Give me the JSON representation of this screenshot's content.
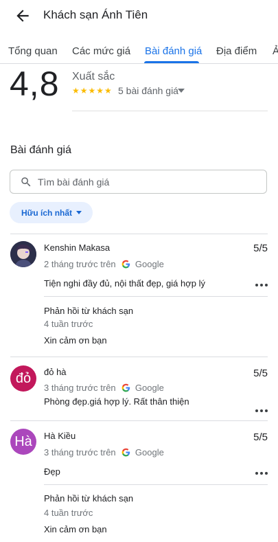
{
  "header": {
    "title": "Khách sạn Ánh Tiên"
  },
  "tabs": [
    {
      "label": "Tổng quan"
    },
    {
      "label": "Các mức giá"
    },
    {
      "label": "Bài đánh giá"
    },
    {
      "label": "Địa điểm"
    },
    {
      "label": "Ả"
    }
  ],
  "summary": {
    "score": "4,8",
    "label": "Xuất sắc",
    "stars": "★★★★★",
    "count": "5 bài đánh giá"
  },
  "reviews_section": {
    "title": "Bài đánh giá",
    "search_placeholder": "Tìm bài đánh giá",
    "sort_label": "Hữu ích nhất"
  },
  "reviews": [
    {
      "name": "Kenshin Makasa",
      "time": "2 tháng trước trên",
      "source": "Google",
      "rating": "5/5",
      "text": "Tiện nghi đầy đủ, nội thất đẹp, giá hợp lý",
      "reply": {
        "title": "Phản hồi từ khách sạn",
        "date": "4 tuần trước",
        "text": "Xin cảm ơn bạn"
      }
    },
    {
      "name": "đỏ hà",
      "initial": "đỏ",
      "avatar_color": "#c2185b",
      "time": "3 tháng trước trên",
      "source": "Google",
      "rating": "5/5",
      "text": "Phòng đẹp.giá hợp lý. Rất thân thiện"
    },
    {
      "name": "Hà Kiều",
      "initial": "Hà",
      "avatar_color": "#ab47bc",
      "time": "3 tháng trước trên",
      "source": "Google",
      "rating": "5/5",
      "text": "Đẹp",
      "reply": {
        "title": "Phản hồi từ khách sạn",
        "date": "4 tuần trước",
        "text": "Xin cảm ơn bạn"
      }
    }
  ]
}
